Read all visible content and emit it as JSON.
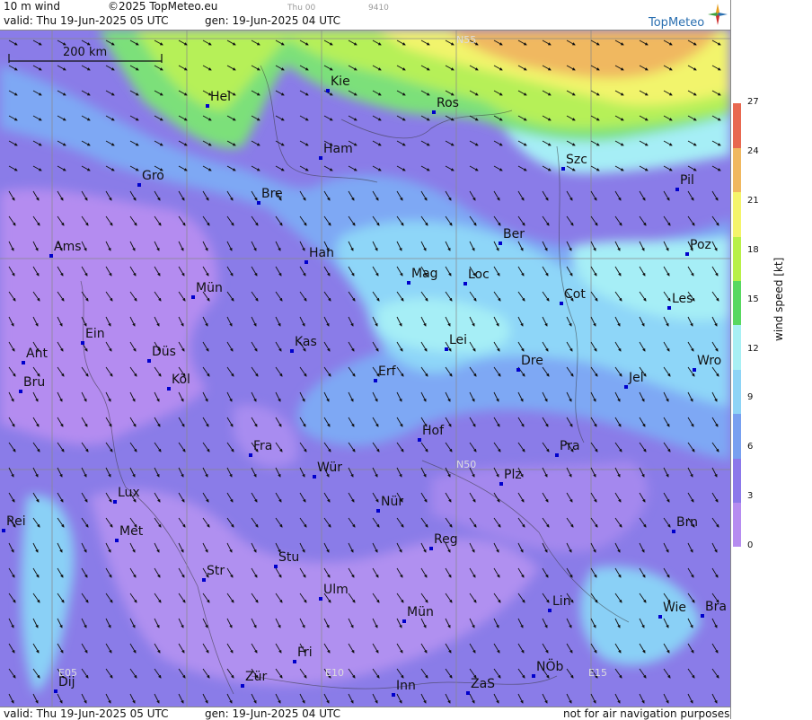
{
  "header": {
    "field": "10 m wind",
    "copyright": "©2025 TopMeteo.eu",
    "small_day": "Thu 00",
    "small_code": "9410",
    "valid": "valid:  Thu  19-Jun-2025  05 UTC",
    "gen": "gen: 19-Jun-2025 04 UTC",
    "brand": "TopMeteo"
  },
  "footer": {
    "valid": "valid:  Thu  19-Jun-2025  05 UTC",
    "gen": "gen: 19-Jun-2025 04 UTC",
    "disclaimer": "not for air navigation purposes"
  },
  "scale": {
    "label": "200 km"
  },
  "grid_labels": [
    "N55",
    "N50",
    "E05",
    "E10",
    "E15"
  ],
  "legend": {
    "axis_label": "wind speed  [kt]",
    "ticks": [
      "27",
      "24",
      "21",
      "18",
      "15",
      "12",
      "9",
      "6",
      "3",
      "0"
    ],
    "colors": [
      "#b68cf0",
      "#8c78ea",
      "#78a0f0",
      "#8ed4f6",
      "#a8f0f4",
      "#58d860",
      "#b8f048",
      "#f4f46a",
      "#f0b860",
      "#e86850"
    ]
  },
  "cities": [
    {
      "name": "Hel"
    },
    {
      "name": "Kie"
    },
    {
      "name": "Ros"
    },
    {
      "name": "Ham"
    },
    {
      "name": "Szc"
    },
    {
      "name": "Gro"
    },
    {
      "name": "Bre"
    },
    {
      "name": "Pil"
    },
    {
      "name": "Ber"
    },
    {
      "name": "Ams"
    },
    {
      "name": "Han"
    },
    {
      "name": "Poz"
    },
    {
      "name": "Mag"
    },
    {
      "name": "Loc"
    },
    {
      "name": "Mün"
    },
    {
      "name": "Cot"
    },
    {
      "name": "Les"
    },
    {
      "name": "Ein"
    },
    {
      "name": "Kas"
    },
    {
      "name": "Lei"
    },
    {
      "name": "Ant"
    },
    {
      "name": "Düs"
    },
    {
      "name": "Wro"
    },
    {
      "name": "Dre"
    },
    {
      "name": "Erf"
    },
    {
      "name": "Bru"
    },
    {
      "name": "Köl"
    },
    {
      "name": "Jel"
    },
    {
      "name": "Hof"
    },
    {
      "name": "Fra"
    },
    {
      "name": "Pra"
    },
    {
      "name": "Wür"
    },
    {
      "name": "Plz"
    },
    {
      "name": "Lux"
    },
    {
      "name": "Nür"
    },
    {
      "name": "Rei"
    },
    {
      "name": "Met"
    },
    {
      "name": "Brn"
    },
    {
      "name": "Reg"
    },
    {
      "name": "Stu"
    },
    {
      "name": "Str"
    },
    {
      "name": "Ulm"
    },
    {
      "name": "Lin"
    },
    {
      "name": "Mün"
    },
    {
      "name": "Wie"
    },
    {
      "name": "Bra"
    },
    {
      "name": "Fri"
    },
    {
      "name": "NÖb"
    },
    {
      "name": "Zür"
    },
    {
      "name": "Dij"
    },
    {
      "name": "Inn"
    },
    {
      "name": "ZaS"
    }
  ]
}
